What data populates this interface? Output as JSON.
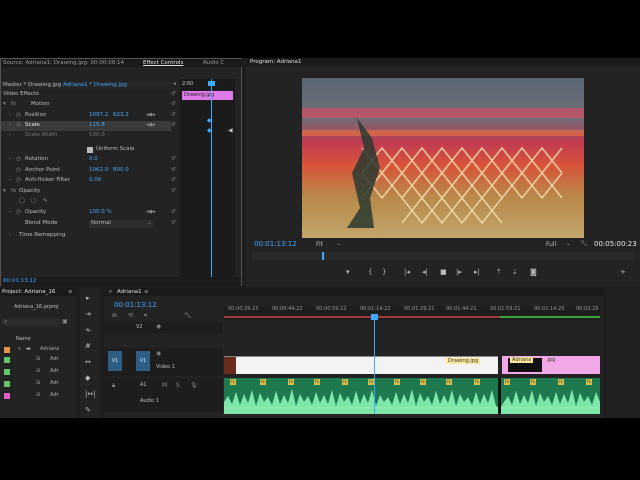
{
  "effect_controls": {
    "tabs": [
      "Source: Adriana1: Drawing.jpg: 00:00:08:14",
      "Effect Controls",
      "Audio C"
    ],
    "master_label": "Master * Drawing.jpg",
    "sequence_label": "Adriana1 * Drawing.jpg",
    "header_time": "2:00",
    "clip_name": "Drawing.jpg",
    "video_effects": "Video Effects",
    "motion": "Motion",
    "position_label": "Position",
    "position_x": "1097.2",
    "position_y": "623.2",
    "scale_label": "Scale",
    "scale_value": "115.8",
    "scale_width_label": "Scale Width",
    "scale_width_value": "100.0",
    "uniform_scale": "Uniform Scale",
    "rotation_label": "Rotation",
    "rotation_value": "0.0",
    "anchor_label": "Anchor Point",
    "anchor_x": "1062.0",
    "anchor_y": "800.0",
    "antiflicker_label": "Anti-flicker Filter",
    "antiflicker_value": "0.00",
    "opacity_section": "Opacity",
    "opacity_label": "Opacity",
    "opacity_value": "100.0 %",
    "blend_label": "Blend Mode",
    "blend_value": "Normal",
    "time_remap": "Time Remapping",
    "footer_time": "00:01:13:12"
  },
  "program": {
    "title": "Program: Adriana1",
    "timecode": "00:01:13:12",
    "fit": "Fit",
    "quality": "Full",
    "duration": "00:05:00:23"
  },
  "project": {
    "title": "Project: Adriana_16",
    "file": "Adriana_16.prproj",
    "name_col": "Name",
    "rows": [
      {
        "label": "Adriana",
        "color": "#e8934a"
      },
      {
        "label": "Adr",
        "color": "#5fc46a"
      },
      {
        "label": "Adr",
        "color": "#5fc46a"
      },
      {
        "label": "Adr",
        "color": "#5fc46a"
      },
      {
        "label": "Adr",
        "color": "#e05fc8"
      }
    ]
  },
  "timeline": {
    "tab": "Adriana1",
    "timecode": "00:01:13:12",
    "ruler": [
      "00:00:29:23",
      "00:00:44:22",
      "00:00:59:22",
      "00:01:14:22",
      "00:01:29:21",
      "00:01:44:21",
      "00:01:59:21",
      "00:02:14:20",
      "00:02:29"
    ],
    "track_v2": "V2",
    "track_v1": "V1",
    "video_label": "Video 1",
    "track_a1": "A1",
    "audio_label": "Audio 1",
    "clip_drawing": "Drawing.jpg",
    "clip_adriana": "Adriana",
    "clip_jpg": ".jpg"
  }
}
